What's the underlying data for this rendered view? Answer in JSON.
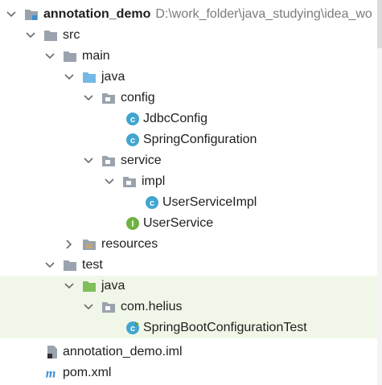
{
  "tree": {
    "root": {
      "name": "annotation_demo",
      "path": "D:\\work_folder\\java_studying\\idea_wo"
    },
    "src": "src",
    "main": "main",
    "main_java": "java",
    "config": "config",
    "jdbc_config": "JdbcConfig",
    "spring_configuration": "SpringConfiguration",
    "service": "service",
    "impl": "impl",
    "user_service_impl": "UserServiceImpl",
    "user_service": "UserService",
    "resources": "resources",
    "test": "test",
    "test_java": "java",
    "com_helius": "com.helius",
    "spring_boot_test": "SpringBootConfigurationTest",
    "iml_file": "annotation_demo.iml",
    "pom_file": "pom.xml"
  },
  "colors": {
    "folder_gray": "#9aa3ad",
    "folder_blue": "#75b8e6",
    "folder_green": "#7fbf5a",
    "class_icon": "#42a5cf",
    "interface_icon": "#6fb241",
    "test_highlight": "#f0f7e8"
  }
}
